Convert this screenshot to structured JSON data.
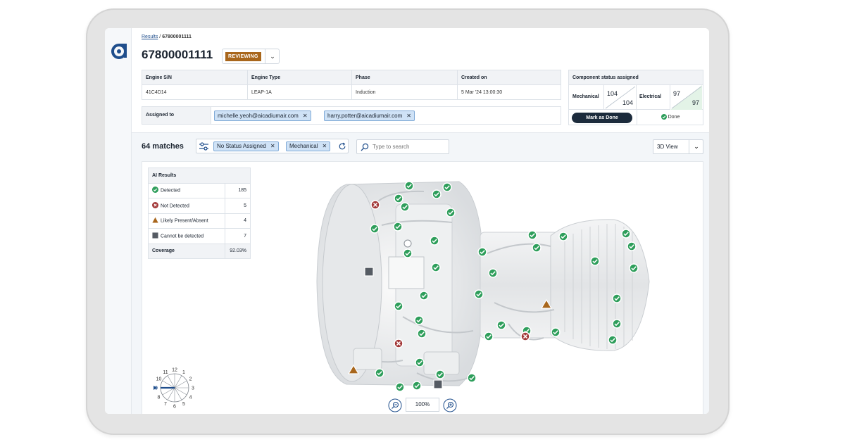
{
  "breadcrumb": {
    "root": "Results",
    "current": "67800001111"
  },
  "record": {
    "id": "67800001111",
    "status": "REVIEWING"
  },
  "info_table": {
    "headers": [
      "Engine S/N",
      "Engine Type",
      "Phase",
      "Created on"
    ],
    "values": [
      "41C4D14",
      "LEAP-1A",
      "Induction",
      "5 Mar '24 13:00:30"
    ]
  },
  "assigned": {
    "label": "Assigned to",
    "users": [
      "michelle.yeoh@aicadiumair.com",
      "harry.potter@aicadiumair.com"
    ]
  },
  "component_status": {
    "title": "Component status assigned",
    "mechanical": {
      "label": "Mechanical",
      "assigned": "104",
      "total": "104"
    },
    "electrical": {
      "label": "Electrical",
      "assigned": "97",
      "total": "97"
    },
    "mark_done_label": "Mark as Done",
    "done_label": "Done"
  },
  "results": {
    "matches_label": "64 matches",
    "filters": [
      "No Status Assigned",
      "Mechanical"
    ],
    "search_placeholder": "Type to search",
    "view_label": "3D View"
  },
  "ai_results": {
    "title": "AI Results",
    "rows": [
      {
        "label": "Detected",
        "value": "185"
      },
      {
        "label": "Not Detected",
        "value": "5"
      },
      {
        "label": "Likely Present/Absent",
        "value": "4"
      },
      {
        "label": "Cannot be detected",
        "value": "7"
      }
    ],
    "coverage_label": "Coverage",
    "coverage_value": "92.03%"
  },
  "zoom": {
    "value": "100%"
  },
  "clock": {
    "labels": [
      "12",
      "1",
      "2",
      "3",
      "4",
      "5",
      "6",
      "7",
      "8",
      "9",
      "10",
      "11"
    ]
  },
  "colors": {
    "detected": "#2e9e5b",
    "not_detected": "#a33a3a",
    "likely": "#a8661c",
    "cannot": "#555b63",
    "status_badge": "#a8661c",
    "primary_button": "#1c2b3c"
  }
}
